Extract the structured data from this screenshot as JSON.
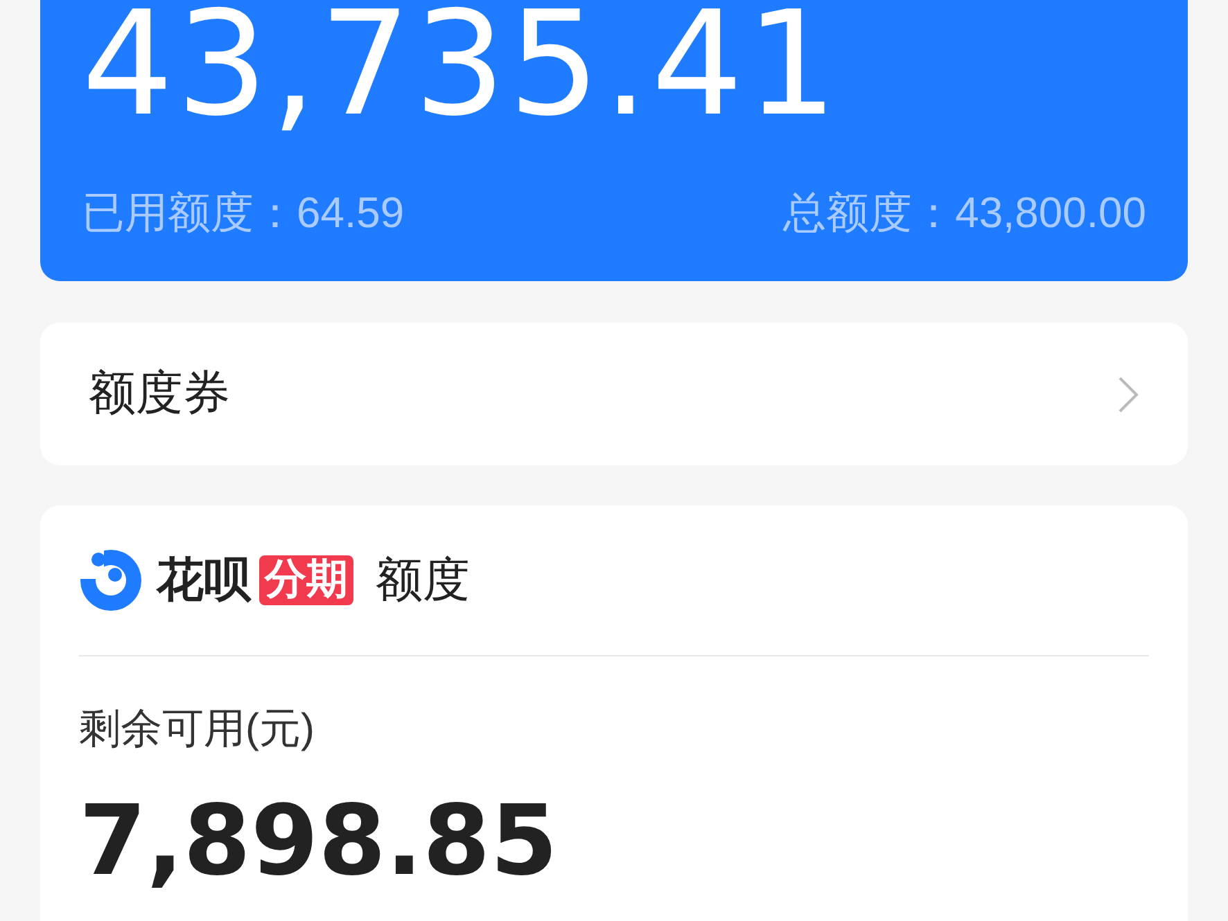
{
  "balance_card": {
    "amount": "43,735.41",
    "used": "已用额度：64.59",
    "total": "总额度：43,800.00"
  },
  "coupon_row": {
    "label": "额度券"
  },
  "installment_card": {
    "brand": "花呗",
    "badge": "分期",
    "title": "额度",
    "caption": "剩余可用(元)",
    "amount": "7,898.85"
  }
}
